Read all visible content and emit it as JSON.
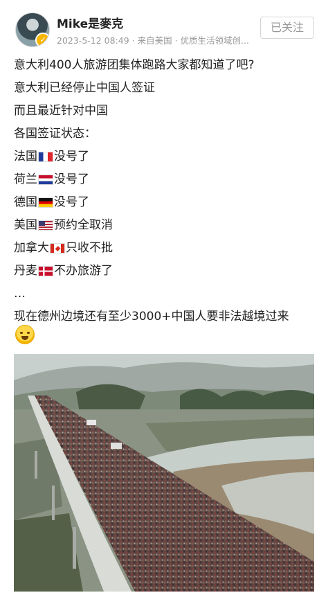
{
  "post": {
    "author": {
      "name": "Mike是麥克",
      "verified_icon": "verified-badge-icon"
    },
    "meta": "2023-5-12 08:49 · 来自美国 · 优质生活领域创...",
    "follow_label": "已关注",
    "lines": {
      "l1": "意大利400人旅游团集体跑路大家都知道了吧?",
      "l2": "意大利已经停止中国人签证",
      "l3": "而且最近针对中国",
      "l4": "各国签证状态：",
      "france": {
        "country": "法国",
        "status": "没号了"
      },
      "netherlands": {
        "country": "荷兰",
        "status": "没号了"
      },
      "germany": {
        "country": "德国",
        "status": "没号了"
      },
      "usa": {
        "country": "美国",
        "status": "预约全取消"
      },
      "canada": {
        "country": "加拿大",
        "status": "只收不批"
      },
      "denmark": {
        "country": "丹麦",
        "status": "不办旅游了"
      },
      "ellipsis": "…",
      "l5": "现在德州边境还有至少3000+中国人要非法越境过来"
    },
    "emoji": "crying-face-icon",
    "photo": "crowd-on-bridge-photo"
  },
  "colors": {
    "text": "#222222",
    "meta": "#999999",
    "button_border": "#d5d5d5"
  }
}
